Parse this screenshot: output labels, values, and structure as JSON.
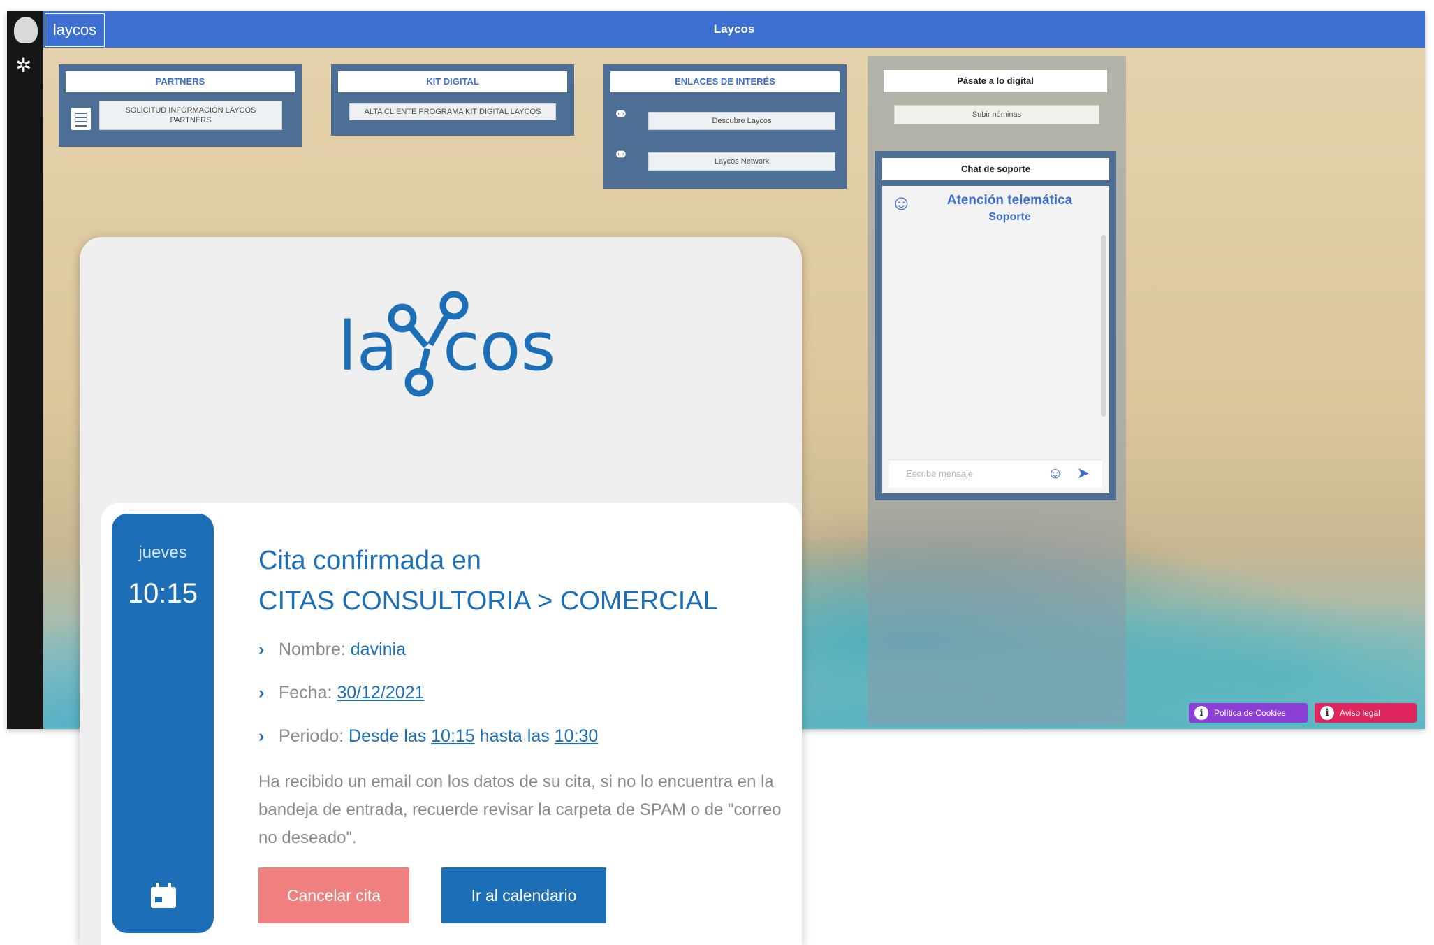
{
  "app": {
    "title": "Laycos",
    "logo_text": "laycos",
    "menu_icon": "asterisk-icon",
    "panels": {
      "partners": {
        "title": "PARTNERS",
        "button": "SOLICITUD INFORMACIÓN LAYCOS PARTNERS"
      },
      "kit_digital": {
        "title": "KIT DIGITAL",
        "button": "ALTA CLIENTE PROGRAMA KIT DIGITAL LAYCOS"
      },
      "enlaces": {
        "title": "ENLACES DE INTERÉS",
        "links": [
          "Descubre Laycos",
          "Laycos Network"
        ]
      },
      "digital": {
        "title": "Pásate a lo digital",
        "button": "Subir nóminas"
      }
    },
    "chat": {
      "title": "Chat de soporte",
      "agent_name": "Atención telemática",
      "agent_role": "Soporte",
      "placeholder": "Escribe mensaje"
    },
    "footer": {
      "cookies": "Política de Cookies",
      "legal": "Aviso legal"
    },
    "colors": {
      "topbar": "#3d6fd1",
      "panel": "#4d6f95",
      "cookies": "#8b3fd6",
      "legal": "#e0245e"
    }
  },
  "confirmation": {
    "logo_text": "laycos",
    "weekday": "jueves",
    "time": "10:15",
    "title_line1": "Cita confirmada en",
    "title_line2": "CITAS CONSULTORIA > COMERCIAL",
    "nombre_label": "Nombre:",
    "nombre_value": "davinia",
    "fecha_label": "Fecha:",
    "fecha_value": "30/12/2021",
    "periodo_label": "Periodo:",
    "periodo_desde": "Desde las",
    "periodo_start": "10:15",
    "periodo_hasta": "hasta las",
    "periodo_end": "10:30",
    "note": "Ha recibido un email con los datos de su cita, si no lo encuentra en la bandeja de entrada, recuerde revisar la carpeta de SPAM o de \"correo no deseado\".",
    "cancel_button": "Cancelar cita",
    "calendar_button": "Ir al calendario",
    "colors": {
      "primary": "#1c6eb7",
      "cancel": "#f07f7f"
    }
  }
}
